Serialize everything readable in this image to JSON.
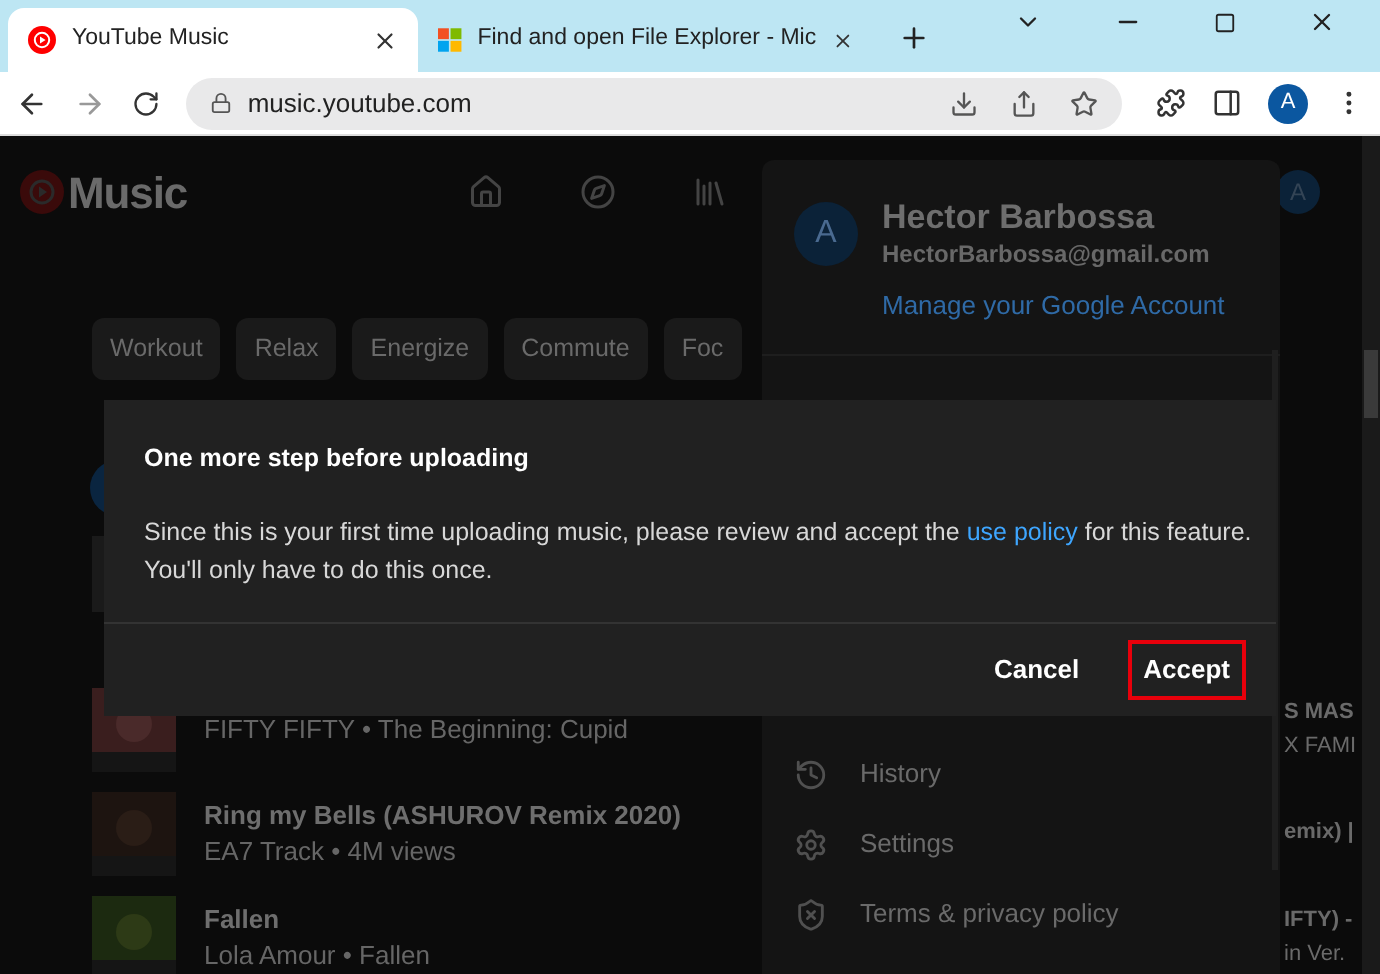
{
  "browser": {
    "tabs": [
      {
        "title": "YouTube Music",
        "selected": true
      },
      {
        "title": "Find and open File Explorer - Mic",
        "selected": false
      }
    ],
    "url": "music.youtube.com",
    "profile_initial": "A"
  },
  "app": {
    "logo_text": "Music",
    "avatar_initial": "A",
    "chips": [
      "Workout",
      "Relax",
      "Energize",
      "Commute",
      "Foc"
    ],
    "songs": [
      {
        "subtitle": "FIFTY FIFTY • The Beginning: Cupid",
        "right_line_1": "S MAS",
        "right_line_2": "X FAMI"
      },
      {
        "title": "Ring my Bells (ASHUROV Remix 2020)",
        "subtitle": "EA7 Track • 4M views",
        "right_line_1": "emix) |"
      },
      {
        "title": "Fallen",
        "subtitle": "Lola Amour • Fallen",
        "right_line_1": "IFTY) -",
        "right_line_2": "in Ver."
      }
    ]
  },
  "account_menu": {
    "initial": "A",
    "name": "Hector Barbossa",
    "email": "HectorBarbossa@gmail.com",
    "manage_link": "Manage your Google Account",
    "items": [
      {
        "label": "History"
      },
      {
        "label": "Settings"
      },
      {
        "label": "Terms & privacy policy"
      }
    ]
  },
  "dialog": {
    "title": "One more step before uploading",
    "body_before": "Since this is your first time uploading music, please review and accept the ",
    "link": "use policy",
    "body_after": " for this feature.",
    "body_line_2": "You'll only have to do this once.",
    "buttons": [
      {
        "label": "Cancel",
        "highlighted": false
      },
      {
        "label": "Accept",
        "highlighted": true
      }
    ]
  }
}
